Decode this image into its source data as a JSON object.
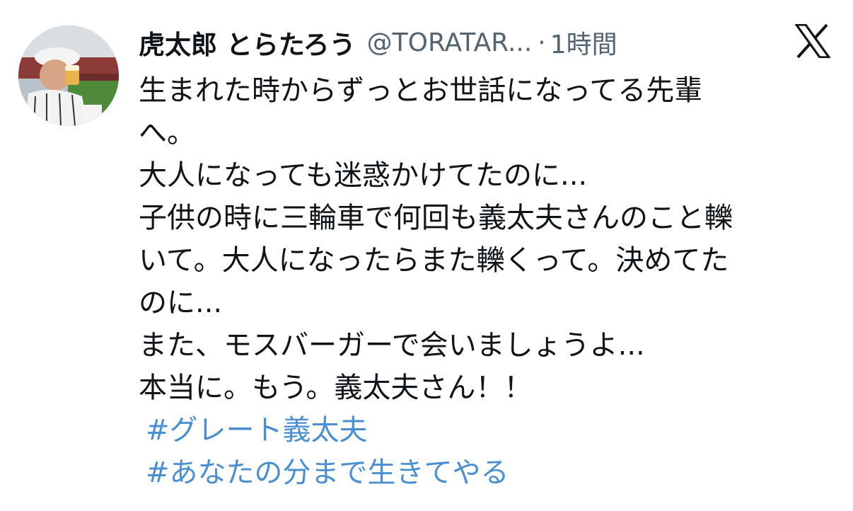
{
  "tweet": {
    "display_name": "虎太郎 とらたろう",
    "handle": "@TORATAR...",
    "separator": "·",
    "time": "1時間",
    "lines": [
      "生まれた時からずっとお世話になってる先輩",
      "へ。",
      "大人になっても迷惑かけてたのに...",
      "子供の時に三輪車で何回も義太夫さんのこと轢",
      "いて。大人になったらまた轢くって。決めてた",
      "のに...",
      "また、モスバーガーで会いましょうよ...",
      "本当に。もう。義太夫さん！！"
    ],
    "hashtags": [
      "#グレート義太夫",
      "#あなたの分まで生きてやる"
    ]
  },
  "icons": {
    "brand": "x-logo-icon",
    "avatar": "user-avatar"
  },
  "colors": {
    "text": "#0f1419",
    "secondary": "#536471",
    "hashtag": "#4a8fd1",
    "background": "#ffffff"
  }
}
